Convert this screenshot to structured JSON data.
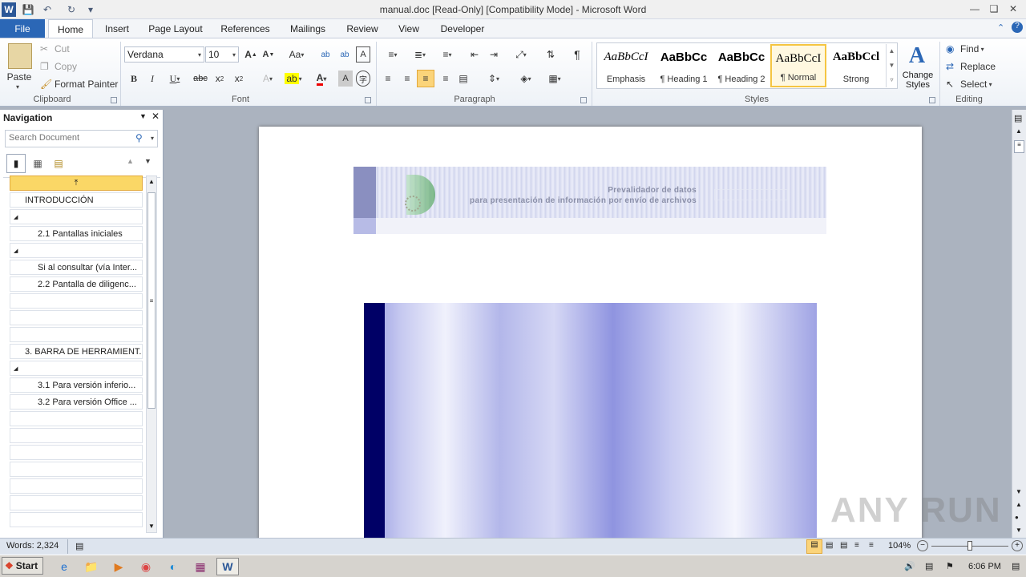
{
  "window": {
    "title": "manual.doc [Read-Only] [Compatibility Mode] - Microsoft Word"
  },
  "tabs": [
    "File",
    "Home",
    "Insert",
    "Page Layout",
    "References",
    "Mailings",
    "Review",
    "View",
    "Developer"
  ],
  "clipboard": {
    "paste": "Paste",
    "cut": "Cut",
    "copy": "Copy",
    "format_painter": "Format Painter",
    "label": "Clipboard"
  },
  "font": {
    "name": "Verdana",
    "size": "10",
    "label": "Font"
  },
  "paragraph": {
    "label": "Paragraph"
  },
  "styles": {
    "label": "Styles",
    "items": [
      {
        "sample": "AaBbCcI",
        "name": "Emphasis"
      },
      {
        "sample": "AaBbCc",
        "name": "¶ Heading 1"
      },
      {
        "sample": "AaBbCc",
        "name": "¶ Heading 2"
      },
      {
        "sample": "AaBbCcI",
        "name": "¶ Normal"
      },
      {
        "sample": "AaBbCcl",
        "name": "Strong"
      }
    ],
    "change_styles": "Change Styles"
  },
  "editing": {
    "find": "Find",
    "replace": "Replace",
    "select": "Select",
    "label": "Editing"
  },
  "navigation": {
    "title": "Navigation",
    "search_placeholder": "Search Document",
    "items": [
      "",
      "INTRODUCCIÓN",
      "",
      "2.1 Pantallas iniciales",
      "",
      "Si al consultar (vía Inter...",
      "2.2 Pantalla de diligenc...",
      "",
      "",
      "",
      "3. BARRA DE HERRAMIENT...",
      "",
      "3.1 Para versión inferio...",
      "3.2 Para versión Office ...",
      "",
      "",
      "",
      "",
      "",
      "",
      ""
    ]
  },
  "document": {
    "header_line1": "Prevalidador de datos",
    "header_line2": "para presentación de información por envío de archivos"
  },
  "status": {
    "words": "Words: 2,324",
    "zoom": "104%"
  },
  "taskbar": {
    "start": "Start",
    "time": "6:06 PM"
  },
  "watermark": "ANY RUN",
  "colors": {
    "file_tab": "#2b67b6",
    "selected_style": "#f5c542",
    "nav_highlight": "#fad766",
    "doc_bar": "#000066"
  }
}
